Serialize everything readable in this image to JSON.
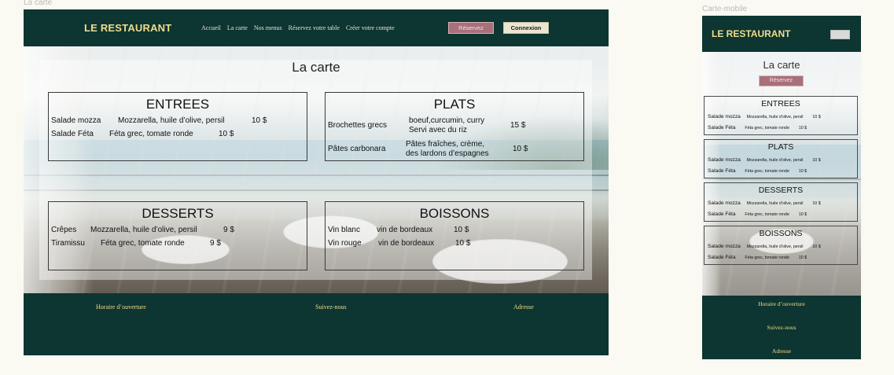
{
  "frames": {
    "desktop_label": "La carte",
    "mobile_label": "Carte-mobile"
  },
  "brand": "LE RESTAURANT",
  "nav": [
    "Accueil",
    "La carte",
    "Nos menus",
    "Réservez votre table",
    "Créer votre compte"
  ],
  "buttons": {
    "reserve": "Réservez",
    "login": "Connexion"
  },
  "page_title": "La carte",
  "desktop": {
    "entrees": {
      "title": "ENTREES",
      "items": [
        {
          "name": "Salade mozza",
          "desc": "Mozzarella, huile d’olive, persil",
          "price": "10 $"
        },
        {
          "name": "Salade Féta",
          "desc": "Féta grec, tomate ronde",
          "price": "10 $"
        }
      ]
    },
    "plats": {
      "title": "PLATS",
      "items": [
        {
          "name": "Brochettes grecs",
          "desc_line1": "boeuf,curcumin, curry",
          "desc_line2": "Servi avec du riz",
          "price": "15 $"
        },
        {
          "name": "Pâtes carbonara",
          "desc_line1": "Pâtes fraîches, crème,",
          "desc_line2": "des lardons d’espagnes",
          "price": "10 $"
        }
      ]
    },
    "desserts": {
      "title": "DESSERTS",
      "items": [
        {
          "name": "Crêpes",
          "desc": "Mozzarella, huile d’olive, persil",
          "price": "9 $"
        },
        {
          "name": "Tiramissu",
          "desc": "Féta grec, tomate ronde",
          "price": "9 $"
        }
      ]
    },
    "boissons": {
      "title": "BOISSONS",
      "items": [
        {
          "name": "Vin blanc",
          "desc": "vin de bordeaux",
          "price": "10 $"
        },
        {
          "name": "Vin rouge",
          "desc": "vin de bordeaux",
          "price": "10 $"
        }
      ]
    }
  },
  "mobile": {
    "sections": [
      {
        "title": "ENTREES",
        "items": [
          {
            "name": "Salade mozza",
            "desc": "Mozzarella, huile d’olive, persil",
            "price": "10 $"
          },
          {
            "name": "Salade Féta",
            "desc": "Féta grec, tomate ronde",
            "price": "10 $"
          }
        ]
      },
      {
        "title": "PLATS",
        "items": [
          {
            "name": "Salade mozza",
            "desc": "Mozzarella, huile d’olive, persil",
            "price": "10 $"
          },
          {
            "name": "Salade Féta",
            "desc": "Féta grec, tomate ronde",
            "price": "10 $"
          }
        ]
      },
      {
        "title": "DESSERTS",
        "items": [
          {
            "name": "Salade mozza",
            "desc": "Mozzarella, huile d’olive, persil",
            "price": "10 $"
          },
          {
            "name": "Salade Féta",
            "desc": "Féta grec, tomate ronde",
            "price": "10 $"
          }
        ]
      },
      {
        "title": "BOISSONS",
        "items": [
          {
            "name": "Salade mozza",
            "desc": "Mozzarella, huile d’olive, persil",
            "price": "10 $"
          },
          {
            "name": "Salade Féta",
            "desc": "Féta grec, tomate ronde",
            "price": "10 $"
          }
        ]
      }
    ]
  },
  "footer": {
    "hours": "Horaire d’ouverture",
    "follow": "Suivez-nous",
    "address": "Adresse"
  },
  "colors": {
    "dark_green": "#0d3531",
    "gold": "#f2dc8b",
    "reserve_button": "#a8707a",
    "login_button": "#ece6d1"
  },
  "icons": {
    "mobile_menu": "hamburger-menu-icon"
  }
}
